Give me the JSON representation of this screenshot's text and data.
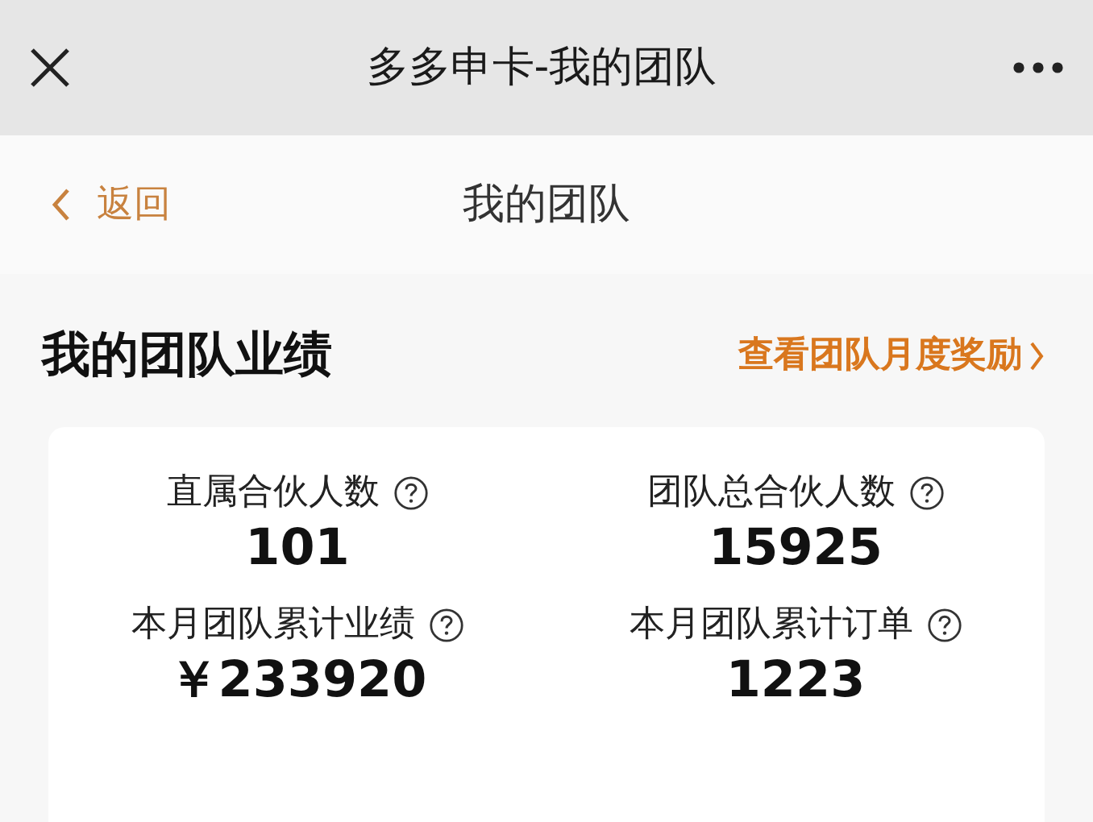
{
  "window": {
    "title": "多多申卡-我的团队"
  },
  "nav": {
    "back": "返回",
    "title": "我的团队"
  },
  "section": {
    "title": "我的团队业绩",
    "link": "查看团队月度奖励"
  },
  "stats": [
    {
      "label": "直属合伙人数",
      "value": "101"
    },
    {
      "label": "团队总合伙人数",
      "value": "15925"
    },
    {
      "label": "本月团队累计业绩",
      "value": "￥233920"
    },
    {
      "label": "本月团队累计订单",
      "value": "1223"
    }
  ]
}
